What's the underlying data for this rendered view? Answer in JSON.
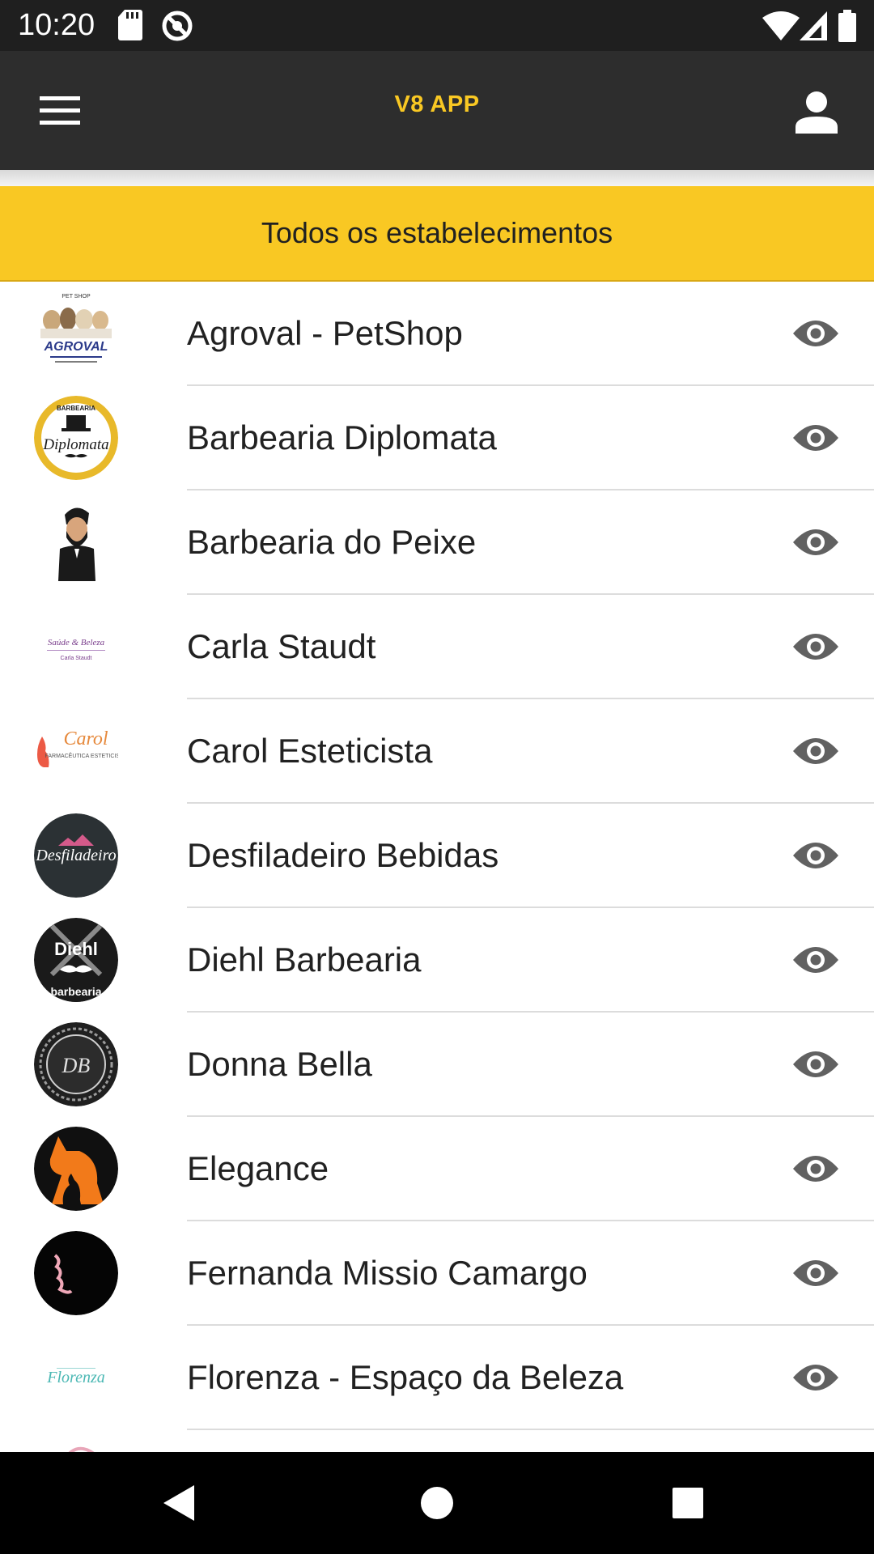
{
  "status_bar": {
    "time": "10:20"
  },
  "app_bar": {
    "title": "V8 APP"
  },
  "filter": {
    "label": "Todos os estabelecimentos"
  },
  "theme": {
    "accent": "#f9c823",
    "app_bar_bg": "#2d2d2d",
    "status_bar_bg": "#1f1f1f",
    "icon_gray": "#616161"
  },
  "establishments": [
    {
      "name": "Agroval - PetShop",
      "logo_text": "AGROVAL",
      "logo_caption": "PET SHOP"
    },
    {
      "name": "Barbearia Diplomata",
      "logo_text": "Diplomata",
      "logo_caption": "BARBEARIA"
    },
    {
      "name": "Barbearia do Peixe",
      "logo_text": "",
      "logo_caption": ""
    },
    {
      "name": "Carla Staudt",
      "logo_text": "Saúde & Beleza",
      "logo_caption": "Carla Staudt"
    },
    {
      "name": "Carol Esteticista",
      "logo_text": "Carol",
      "logo_caption": "FARMACÊUTICA ESTETICISTA"
    },
    {
      "name": "Desfiladeiro Bebidas",
      "logo_text": "Desfiladeiro",
      "logo_caption": ""
    },
    {
      "name": "Diehl Barbearia",
      "logo_text": "Diehl",
      "logo_caption": "barbearia"
    },
    {
      "name": "Donna Bella",
      "logo_text": "DB",
      "logo_caption": ""
    },
    {
      "name": "Elegance",
      "logo_text": "",
      "logo_caption": ""
    },
    {
      "name": "Fernanda Missio Camargo",
      "logo_text": "",
      "logo_caption": ""
    },
    {
      "name": "Florenza - Espaço da Beleza",
      "logo_text": "Florenza",
      "logo_caption": ""
    }
  ]
}
